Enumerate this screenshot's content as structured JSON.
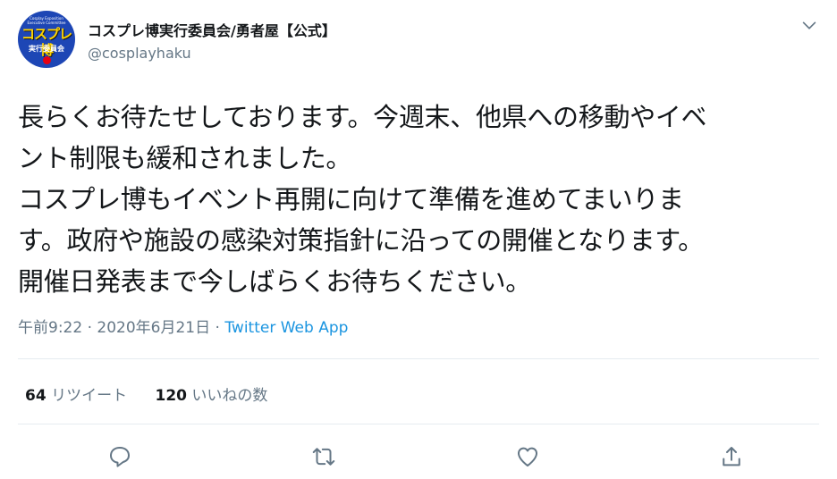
{
  "tweet": {
    "author": {
      "name": "コスプレ博実行委員会/勇者屋【公式】",
      "handle": "@cosplayhaku",
      "avatar": {
        "small_text_1": "Cosplay Exposition",
        "small_text_2": "Executive Committee",
        "logo_text": "コスプレ博",
        "sub_text": "実行委員会"
      }
    },
    "text_lines": [
      "長らくお待たせしております。今週末、他県への移動やイベ",
      "ント制限も緩和されました。",
      "コスプレ博もイベント再開に向けて準備を進めてまいりま",
      "す。政府や施設の感染対策指針に沿っての開催となります。",
      "開催日発表まで今しばらくお待ちください。"
    ],
    "meta": {
      "time": "午前9:22",
      "separator": " · ",
      "date": "2020年6月21日",
      "app": "Twitter Web App"
    },
    "stats": {
      "retweets_count": "64",
      "retweets_label": "リツイート",
      "likes_count": "120",
      "likes_label": "いいねの数"
    }
  },
  "icons": {
    "menu": "chevron-down-icon",
    "reply": "reply-icon",
    "retweet": "retweet-icon",
    "like": "heart-icon",
    "share": "share-icon"
  },
  "colors": {
    "text": "#14171a",
    "secondary": "#657786",
    "link": "#1b95e0",
    "divider": "#e6ecf0",
    "avatar_bg": "#1d46b5",
    "avatar_logo": "#ffd400",
    "avatar_dot": "#e60012"
  }
}
